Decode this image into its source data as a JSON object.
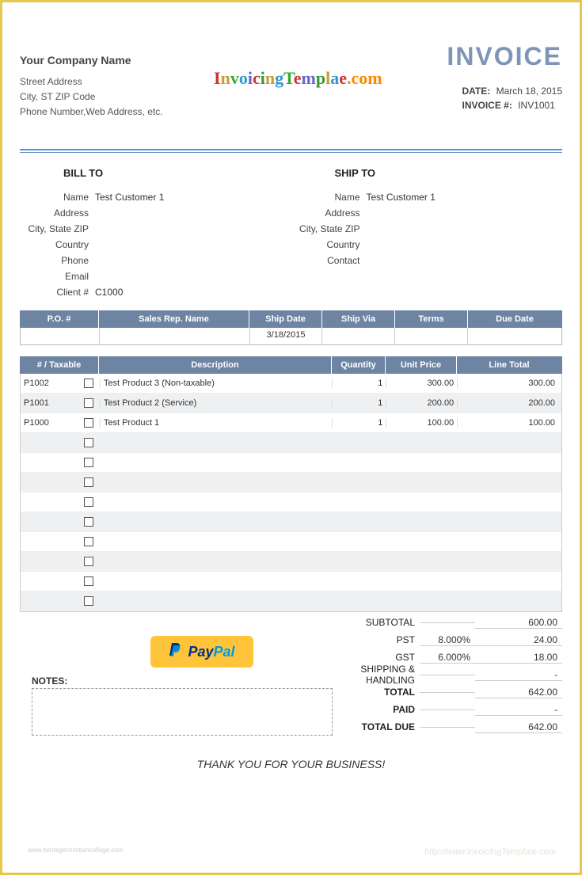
{
  "company": {
    "name": "Your Company Name",
    "street": "Street Address",
    "city": "City, ST  ZIP Code",
    "contact": "Phone Number,Web Address, etc."
  },
  "logo_text": "InvoicingTemplae.com",
  "title": "INVOICE",
  "meta": {
    "date_label": "DATE:",
    "date": "March 18, 2015",
    "invno_label": "INVOICE #:",
    "invno": "INV1001"
  },
  "billto": {
    "heading": "BILL TO",
    "labels": [
      "Name",
      "Address",
      "City, State ZIP",
      "Country",
      "Phone",
      "Email",
      "Client #"
    ],
    "values": [
      "Test Customer 1",
      "",
      "",
      "",
      "",
      "",
      "C1000"
    ]
  },
  "shipto": {
    "heading": "SHIP TO",
    "labels": [
      "Name",
      "Address",
      "City, State ZIP",
      "Country",
      "Contact"
    ],
    "values": [
      "Test Customer 1",
      "",
      "",
      "",
      ""
    ]
  },
  "po": {
    "headers": [
      "P.O. #",
      "Sales Rep. Name",
      "Ship Date",
      "Ship Via",
      "Terms",
      "Due Date"
    ],
    "row": [
      "",
      "",
      "3/18/2015",
      "",
      "",
      ""
    ]
  },
  "items": {
    "headers": [
      "# / Taxable",
      "Description",
      "Quantity",
      "Unit Price",
      "Line Total"
    ],
    "rows": [
      {
        "id": "P1002",
        "desc": "Test Product 3 (Non-taxable)",
        "qty": "1",
        "price": "300.00",
        "total": "300.00"
      },
      {
        "id": "P1001",
        "desc": "Test Product 2 (Service)",
        "qty": "1",
        "price": "200.00",
        "total": "200.00"
      },
      {
        "id": "P1000",
        "desc": "Test Product 1",
        "qty": "1",
        "price": "100.00",
        "total": "100.00"
      },
      {
        "id": "",
        "desc": "",
        "qty": "",
        "price": "",
        "total": ""
      },
      {
        "id": "",
        "desc": "",
        "qty": "",
        "price": "",
        "total": ""
      },
      {
        "id": "",
        "desc": "",
        "qty": "",
        "price": "",
        "total": ""
      },
      {
        "id": "",
        "desc": "",
        "qty": "",
        "price": "",
        "total": ""
      },
      {
        "id": "",
        "desc": "",
        "qty": "",
        "price": "",
        "total": ""
      },
      {
        "id": "",
        "desc": "",
        "qty": "",
        "price": "",
        "total": ""
      },
      {
        "id": "",
        "desc": "",
        "qty": "",
        "price": "",
        "total": ""
      },
      {
        "id": "",
        "desc": "",
        "qty": "",
        "price": "",
        "total": ""
      },
      {
        "id": "",
        "desc": "",
        "qty": "",
        "price": "",
        "total": ""
      }
    ]
  },
  "totals": {
    "subtotal_label": "SUBTOTAL",
    "subtotal": "600.00",
    "pst_label": "PST",
    "pst_pct": "8.000%",
    "pst": "24.00",
    "gst_label": "GST",
    "gst_pct": "6.000%",
    "gst": "18.00",
    "ship_label": "SHIPPING & HANDLING",
    "ship": "-",
    "total_label": "TOTAL",
    "total": "642.00",
    "paid_label": "PAID",
    "paid": "-",
    "due_label": "TOTAL DUE",
    "due": "642.00"
  },
  "paypal": {
    "text_pay": "Pay",
    "text_pal": "Pal"
  },
  "notes_label": "NOTES:",
  "thanks": "THANK YOU FOR YOUR BUSINESS!",
  "watermark1": "www.heritagechristiancollege.com",
  "watermark2": "http://www.InvoicingTemplate.com"
}
